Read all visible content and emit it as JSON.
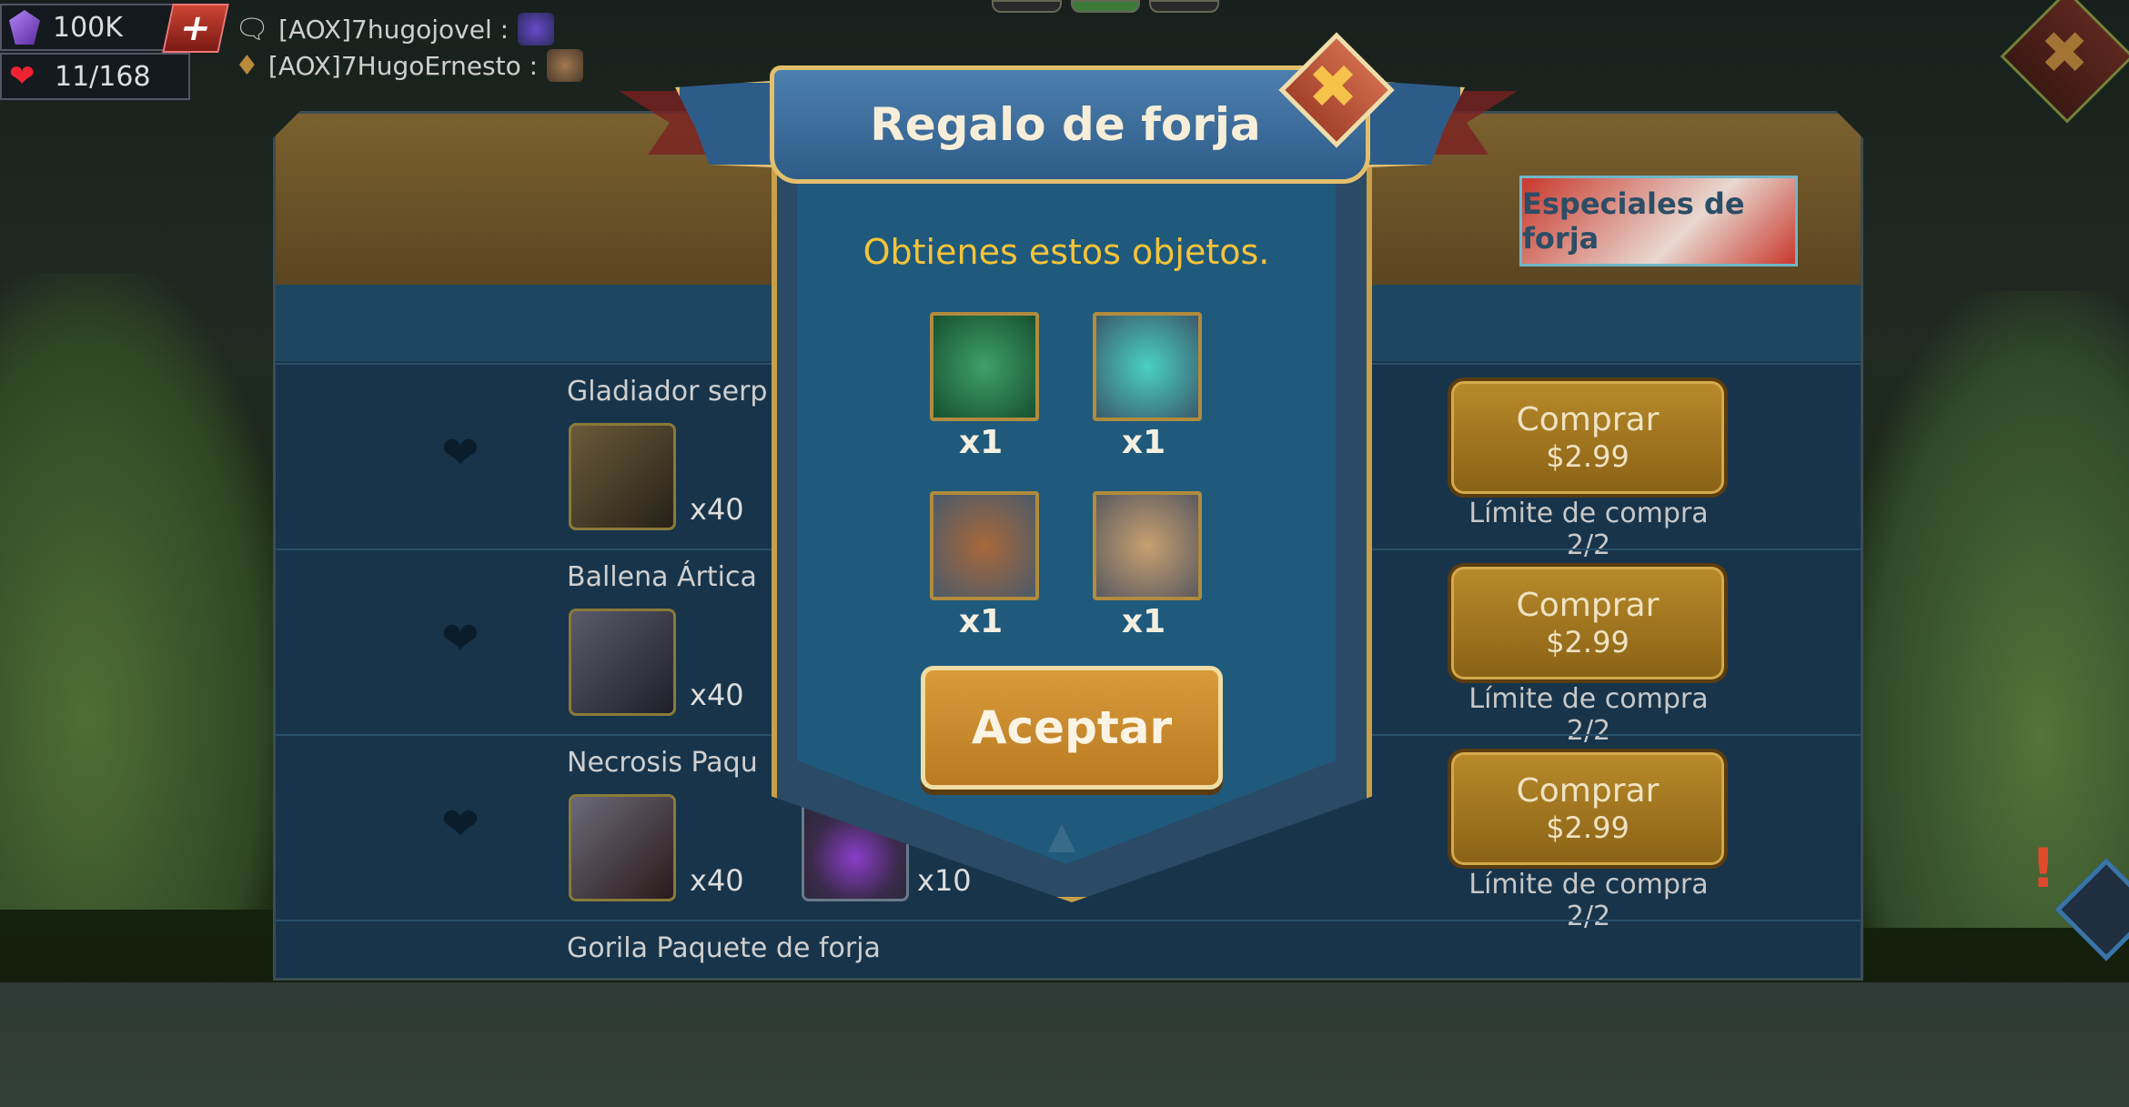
{
  "hud": {
    "gems": "100K",
    "stamina": "11/168",
    "add_label": "+",
    "chat": [
      {
        "name": "[AOX]7hugojovel :"
      },
      {
        "name": "[AOX]7HugoErnesto :"
      }
    ]
  },
  "store": {
    "special_label": "Especiales de forja",
    "rows": [
      {
        "name": "Gladiador serp",
        "qty": "x40",
        "buy_label": "Comprar",
        "price": "$2.99",
        "limit": "Límite de compra 2/2"
      },
      {
        "name": "Ballena Ártica",
        "qty": "x40",
        "buy_label": "Comprar",
        "price": "$2.99",
        "limit": "Límite de compra 2/2"
      },
      {
        "name": "Necrosis Paqu",
        "qty": "x40",
        "qty2": "x10",
        "buy_label": "Comprar",
        "price": "$2.99",
        "limit": "Límite de compra 2/2"
      },
      {
        "name": "Gorila Paquete de forja"
      }
    ]
  },
  "modal": {
    "title": "Regalo de forja",
    "subtitle": "Obtienes estos objetos.",
    "items": [
      {
        "icon": "green-doll-icon",
        "qty": "x1"
      },
      {
        "icon": "teal-amulet-icon",
        "qty": "x1"
      },
      {
        "icon": "wooden-artifact-icon",
        "qty": "x1"
      },
      {
        "icon": "scroll-tome-icon",
        "qty": "x1"
      }
    ],
    "accept_label": "Aceptar",
    "close_icon": "close-icon"
  },
  "colors": {
    "title_gold": "#f5c339",
    "button_gold": "#d89b3a",
    "panel_blue": "#1f5a7c"
  }
}
